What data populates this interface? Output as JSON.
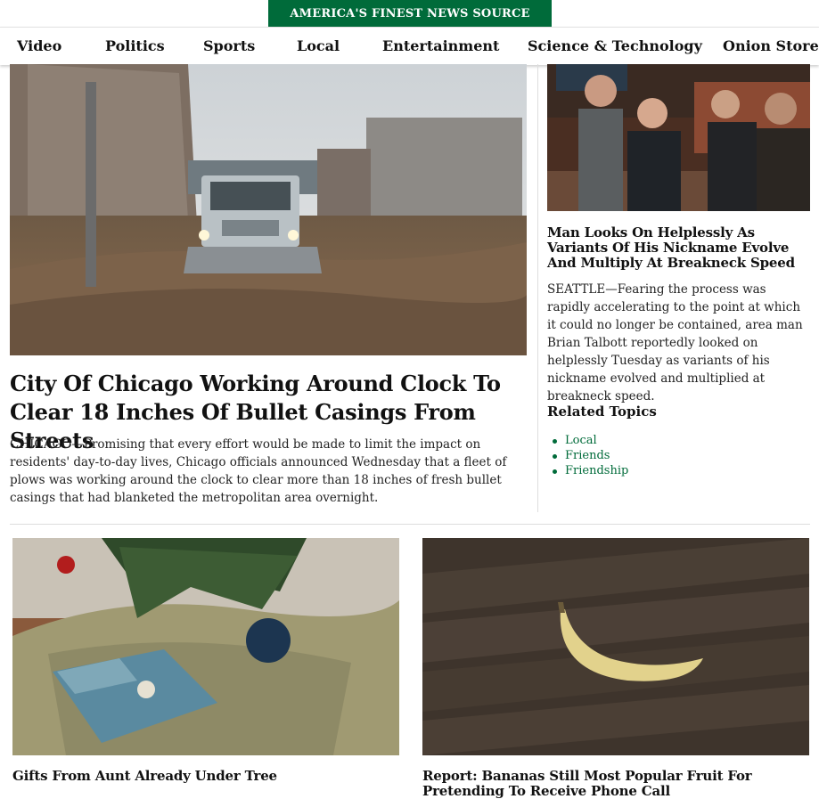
{
  "brand": {
    "tagline": "AMERICA'S FINEST NEWS SOURCE"
  },
  "nav": {
    "items": [
      "Video",
      "Politics",
      "Sports",
      "Local",
      "Entertainment",
      "Science & Technology",
      "Onion Store"
    ]
  },
  "main_story": {
    "title": "City Of Chicago Working Around Clock To Clear 18 Inches Of Bullet Casings From Streets",
    "dek": "CHICAGO—Promising that every effort would be made to limit the impact on residents' day-to-day lives, Chicago officials announced Wednesday that a fleet of plows was working around the clock to clear more than 18 inches of fresh bullet casings that had blanketed the metropolitan area overnight."
  },
  "side_story": {
    "title": "Man Looks On Helplessly As Variants Of His Nickname Evolve And Multiply At Breakneck Speed",
    "dek": "SEATTLE—Fearing the process was rapidly accelerating to the point at which it could no longer be contained, area man Brian Talbott reportedly looked on helplessly Tuesday as variants of his nickname evolved and multiplied at breakneck speed.",
    "related_heading": "Related Topics",
    "related_topics": [
      "Local",
      "Friends",
      "Friendship"
    ]
  },
  "cards": [
    {
      "title": "Gifts From Aunt Already Under Tree"
    },
    {
      "title": "Report: Bananas Still Most Popular Fruit For Pretending To Receive Phone Call"
    }
  ],
  "colors": {
    "brand_green": "#006b3a",
    "text": "#111111",
    "divider": "#dddddd"
  }
}
